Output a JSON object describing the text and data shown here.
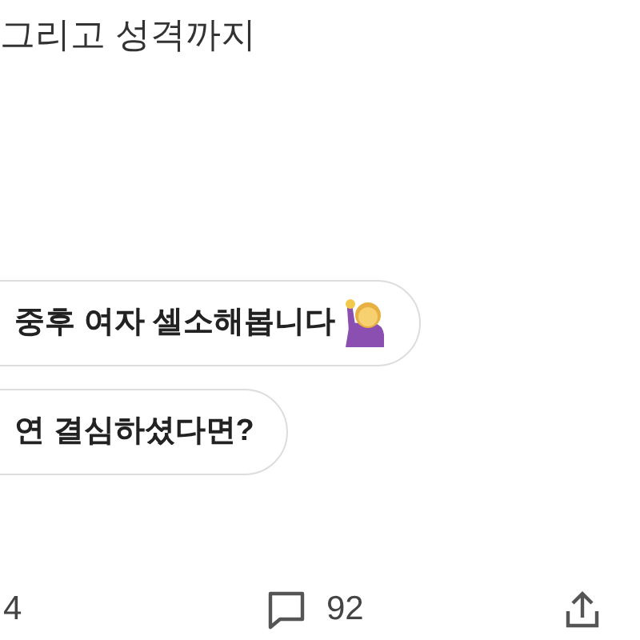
{
  "post_text": "그리고 성격까지",
  "messages": [
    {
      "text": "중후 여자 셀소해봅니다",
      "emoji": true
    },
    {
      "text": "연 결심하셨다면?",
      "emoji": false
    }
  ],
  "actions": {
    "likes": "4",
    "comments": "92"
  }
}
